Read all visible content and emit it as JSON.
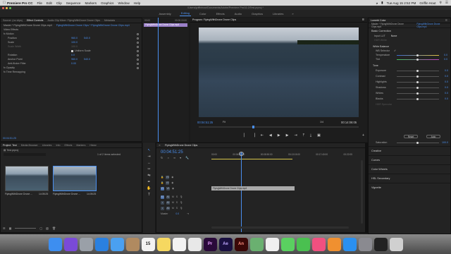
{
  "menubar": {
    "app_name": "Premiere Pro CC",
    "items": [
      "File",
      "Edit",
      "Clip",
      "Sequence",
      "Markers",
      "Graphics",
      "Window",
      "Help"
    ],
    "datetime": "Tue Aug 15 2:52 PM",
    "user": "Griffin Hout"
  },
  "titlebar": {
    "path": "/Users/griffinhout/Documents/Adobe/Premiere Pro/11.0/Test.prproj *"
  },
  "workspaces": [
    "Assembly",
    "Editing",
    "Color",
    "Effects",
    "Audio",
    "Graphics",
    "Libraries"
  ],
  "workspace_active": "Editing",
  "source_tabs": [
    "Source: (no clips)",
    "Effect Controls",
    "Audio Clip Mixer: FlyingWithDrone Drone Clips",
    "Metadata"
  ],
  "effect_controls": {
    "master": "Master * FlyingWithDrone Drone Clips.mp4",
    "sequence": "FlyingWithDrone Drone Clips * FlyingWithDrone Drone Clips.mp4",
    "clip_label": "FlyingWithDrone Drone Clips.mp4",
    "start_tc": "00:00",
    "end_tc": "00:00:15:00",
    "header": "Video Effects",
    "motion": "fx  Motion",
    "position": {
      "label": "Position",
      "x": "960.0",
      "y": "540.0"
    },
    "scale": {
      "label": "Scale",
      "value": "100.0"
    },
    "scale_width": {
      "label": "Scale Width",
      "value": "100.0"
    },
    "uniform_scale": "Uniform Scale",
    "rotation": {
      "label": "Rotation",
      "value": "0.0"
    },
    "anchor": {
      "label": "Anchor Point",
      "x": "960.0",
      "y": "540.0"
    },
    "antiflicker": {
      "label": "Anti-flicker Filter",
      "value": "0.00"
    },
    "opacity": "fx  Opacity",
    "time_remap": "fx  Time Remapping",
    "timecode": "00:04:51:25"
  },
  "program": {
    "title": "Program: FlyingWithDrone Drone Clips",
    "timecode": "00:04:51:25",
    "fit": "Fit",
    "fraction": "1/4",
    "duration": "00:14:06:05"
  },
  "project": {
    "tabs": [
      "Project: Test",
      "Media Browser",
      "Libraries",
      "Info",
      "Effects",
      "Markers",
      "Histor"
    ],
    "file": "Test.prproj",
    "count": "1 of 2 items selected",
    "items": [
      {
        "name": "FlyingWithDrone Drone ...",
        "duration": "14:05:25"
      },
      {
        "name": "FlyingWithDrone Drone ...",
        "duration": "14:05:25"
      }
    ]
  },
  "timeline": {
    "title": "FlyingWithDrone Drone Clips",
    "timecode": "00:04:51:25",
    "ruler": [
      "00:00",
      "00:04:25:00",
      "00:08:50:00",
      "00:13:15:00",
      "00:17:40:00",
      "00:22:05"
    ],
    "video_tracks": [
      "V3",
      "V2",
      "V1"
    ],
    "audio_tracks": [
      "A1",
      "A2",
      "A3"
    ],
    "master": "Master",
    "master_val": "0.0",
    "clip": "FlyingWithDrone Drone Clips.mp4",
    "track_btns": [
      "M",
      "S"
    ]
  },
  "lumetri": {
    "title": "Lumetri Color",
    "clip": "Master * FlyingWithDrone Drone Clips.mp4",
    "sequence_clip": "FlyingWithDrone Drone Clips.mp4",
    "basic": "Basic Correction",
    "input_lut": "Input LUT",
    "lut_value": "None",
    "hdr_white": "HDR White",
    "white_balance": "White Balance",
    "wb_selector": "WB Selector",
    "temperature": "Temperature",
    "tint": "Tint",
    "tone": "Tone",
    "tone_items": [
      "Exposure",
      "Contrast",
      "Highlights",
      "Shadows",
      "Whites",
      "Blacks",
      "HDR Specular"
    ],
    "tone_values": [
      "0.0",
      "0.0",
      "0.0",
      "0.0",
      "0.0",
      "0.0",
      "0.0"
    ],
    "temp_value": "0.0",
    "tint_value": "0.0",
    "reset": "Reset",
    "auto": "Auto",
    "saturation": "Saturation",
    "saturation_value": "100.0",
    "sections": [
      "Creative",
      "Curves",
      "Color Wheels",
      "HSL Secondary",
      "Vignette"
    ]
  },
  "dock": [
    {
      "name": "finder-icon",
      "color": "#3d8ef0",
      "label": ""
    },
    {
      "name": "siri-icon",
      "color": "#7a4ad8",
      "label": ""
    },
    {
      "name": "launchpad-icon",
      "color": "#9aa0a8",
      "label": ""
    },
    {
      "name": "safari-icon",
      "color": "#2a80e0",
      "label": ""
    },
    {
      "name": "mail-icon",
      "color": "#4aa0f0",
      "label": ""
    },
    {
      "name": "contacts-icon",
      "color": "#b08a60",
      "label": ""
    },
    {
      "name": "calendar-icon",
      "color": "#f2f2f2",
      "label": "15"
    },
    {
      "name": "notes-icon",
      "color": "#f6d860",
      "label": ""
    },
    {
      "name": "reminders-icon",
      "color": "#f2f2f2",
      "label": ""
    },
    {
      "name": "chrome-icon",
      "color": "#e8e8e8",
      "label": ""
    },
    {
      "name": "premiere-icon",
      "color": "#2a0a3a",
      "label": "Pr"
    },
    {
      "name": "after-effects-icon",
      "color": "#1a1040",
      "label": "Ae"
    },
    {
      "name": "animate-icon",
      "color": "#3a0808",
      "label": "An"
    },
    {
      "name": "maps-icon",
      "color": "#6ab070",
      "label": ""
    },
    {
      "name": "photos-icon",
      "color": "#f0f0f0",
      "label": ""
    },
    {
      "name": "messages-icon",
      "color": "#5ad060",
      "label": ""
    },
    {
      "name": "facetime-icon",
      "color": "#4ac050",
      "label": ""
    },
    {
      "name": "itunes-icon",
      "color": "#f05080",
      "label": ""
    },
    {
      "name": "ibooks-icon",
      "color": "#f09030",
      "label": ""
    },
    {
      "name": "app-store-icon",
      "color": "#2a90f0",
      "label": ""
    },
    {
      "name": "system-preferences-icon",
      "color": "#8a8a90",
      "label": ""
    },
    {
      "name": "terminal-icon",
      "color": "#222222",
      "label": ""
    },
    {
      "name": "trash-icon",
      "color": "#d0d0d0",
      "label": ""
    }
  ]
}
